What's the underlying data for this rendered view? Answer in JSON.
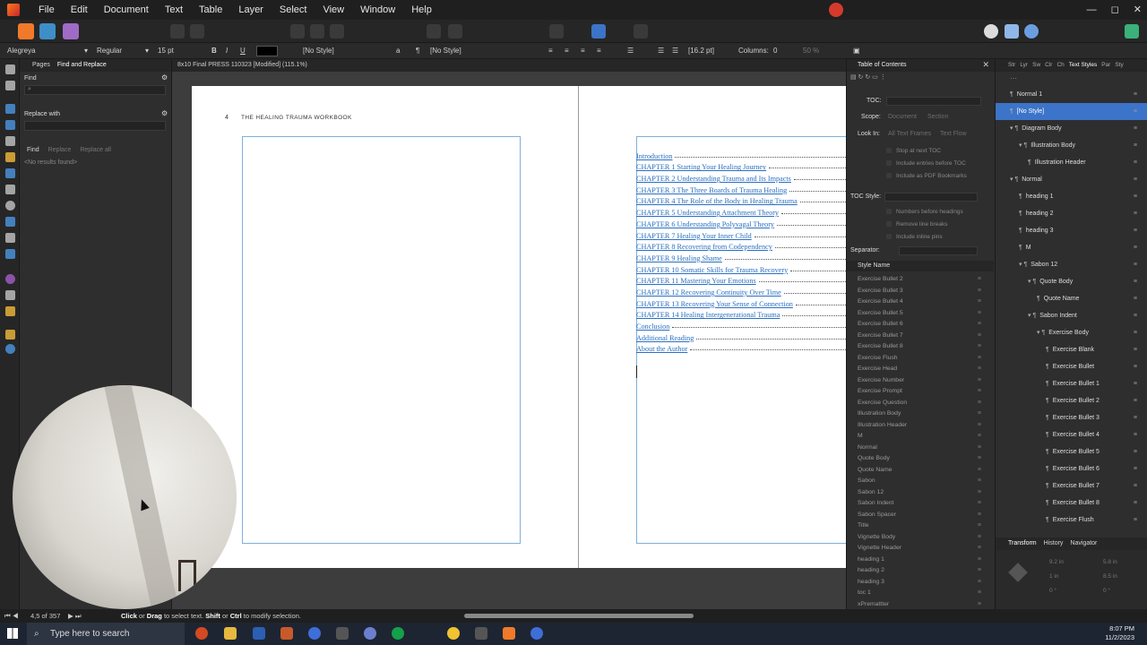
{
  "app": {
    "menus": [
      "File",
      "Edit",
      "Document",
      "Text",
      "Table",
      "Layer",
      "Select",
      "View",
      "Window",
      "Help"
    ],
    "window_controls": [
      "—",
      "◻",
      "✕"
    ]
  },
  "context_bar": {
    "font": "Alegreya",
    "weight": "Regular",
    "size": "15 pt",
    "bold": "B",
    "italic": "I",
    "underline": "U",
    "char_style": "[No Style]",
    "para_style": "[No Style]",
    "leading": "[16.2 pt]",
    "columns_label": "Columns:",
    "columns_value": "0",
    "zoom": "50 %"
  },
  "find_panel": {
    "tabs": [
      "Pages",
      "Find and Replace"
    ],
    "find_label": "Find",
    "find_placeholder": "",
    "replace_label": "Replace with",
    "find_btn": "Find",
    "replace_btn": "Replace",
    "replace_all_btn": "Replace all",
    "results": "<No results found>"
  },
  "document": {
    "tab_title": "8x10 Final PRESS 110323 [Modified] (115.1%)",
    "page_number": "4",
    "running_head": "THE HEALING TRAUMA WORKBOOK",
    "toc_entries": [
      "Introduction",
      "CHAPTER 1 Starting Your Healing Journey",
      "CHAPTER 2 Understanding Trauma and Its Impacts",
      "CHAPTER 3 The Three Boards of Trauma Healing",
      "CHAPTER 4 The Role of the Body in Healing Trauma",
      "CHAPTER 5 Understanding Attachment Theory",
      "CHAPTER 6 Understanding Polyvagal Theory",
      "CHAPTER 7 Healing Your Inner Child",
      "CHAPTER 8 Recovering from Codependency",
      "CHAPTER 9 Healing Shame",
      "CHAPTER 10 Somatic Skills for Trauma Recovery",
      "CHAPTER 11 Mastering Your Emotions",
      "CHAPTER 12 Recovering Continuity Over Time",
      "CHAPTER 13 Recovering Your Sense of Connection",
      "CHAPTER 14 Healing Intergenerational Trauma",
      "Conclusion",
      "Additional Reading",
      "About the Author"
    ]
  },
  "toc_panel": {
    "title": "Table of Contents",
    "toc_label": "TOC:",
    "scope_label": "Scope:",
    "scope_options": [
      "Document",
      "Section"
    ],
    "look_in_label": "Look In:",
    "look_in_options": [
      "All Text Frames",
      "Text Flow"
    ],
    "checks": [
      "Stop at next TOC",
      "Include entries before TOC",
      "Include as PDF Bookmarks"
    ],
    "toc_style_label": "TOC Style:",
    "style_checks": [
      "Numbers before headings",
      "Remove line breaks",
      "Include inline pins"
    ],
    "separator_label": "Separator:",
    "style_name_header": "Style Name",
    "styles": [
      "Exercise Bullet 2",
      "Exercise Bullet 3",
      "Exercise Bullet 4",
      "Exercise Bullet 5",
      "Exercise Bullet 6",
      "Exercise Bullet 7",
      "Exercise Bullet 8",
      "Exercise Flush",
      "Exercise Head",
      "Exercise Number",
      "Exercise Prompt",
      "Exercise Question",
      "Illustration Body",
      "Illustration Header",
      "M",
      "Normal",
      "Quote Body",
      "Quote Name",
      "Sabon",
      "Sabon 12",
      "Sabon Indent",
      "Sabon Spacer",
      "Title",
      "Vignette Body",
      "Vignette Header",
      "heading 1",
      "heading 2",
      "heading 3",
      "toc 1",
      "xPremattter"
    ]
  },
  "styles_panel": {
    "tabs": [
      "Str",
      "Lyr",
      "Sw",
      "Clr",
      "Ch",
      "Text Styles",
      "Par",
      "Sty"
    ],
    "active_tab": "Text Styles",
    "tree": [
      {
        "label": "Normal 1",
        "indent": 1,
        "selected": false,
        "marker": "¶"
      },
      {
        "label": "[No Style]",
        "indent": 1,
        "selected": true,
        "marker": "¶"
      },
      {
        "label": "Diagram Body",
        "indent": 1,
        "selected": false,
        "marker": "▾ ¶"
      },
      {
        "label": "Illustration Body",
        "indent": 2,
        "selected": false,
        "marker": "▾ ¶"
      },
      {
        "label": "Illustration Header",
        "indent": 3,
        "selected": false,
        "marker": "¶"
      },
      {
        "label": "Normal",
        "indent": 1,
        "selected": false,
        "marker": "▾ ¶"
      },
      {
        "label": "heading 1",
        "indent": 2,
        "selected": false,
        "marker": "¶"
      },
      {
        "label": "heading 2",
        "indent": 2,
        "selected": false,
        "marker": "¶"
      },
      {
        "label": "heading 3",
        "indent": 2,
        "selected": false,
        "marker": "¶"
      },
      {
        "label": "M",
        "indent": 2,
        "selected": false,
        "marker": "¶"
      },
      {
        "label": "Sabon 12",
        "indent": 2,
        "selected": false,
        "marker": "▾ ¶"
      },
      {
        "label": "Quote Body",
        "indent": 3,
        "selected": false,
        "marker": "▾ ¶"
      },
      {
        "label": "Quote Name",
        "indent": 4,
        "selected": false,
        "marker": "¶"
      },
      {
        "label": "Sabon Indent",
        "indent": 3,
        "selected": false,
        "marker": "▾ ¶"
      },
      {
        "label": "Exercise Body",
        "indent": 4,
        "selected": false,
        "marker": "▾ ¶"
      },
      {
        "label": "Exercise Blank",
        "indent": 5,
        "selected": false,
        "marker": "¶"
      },
      {
        "label": "Exercise Bullet",
        "indent": 5,
        "selected": false,
        "marker": "¶"
      },
      {
        "label": "Exercise Bullet 1",
        "indent": 5,
        "selected": false,
        "marker": "¶"
      },
      {
        "label": "Exercise Bullet 2",
        "indent": 5,
        "selected": false,
        "marker": "¶"
      },
      {
        "label": "Exercise Bullet 3",
        "indent": 5,
        "selected": false,
        "marker": "¶"
      },
      {
        "label": "Exercise Bullet 4",
        "indent": 5,
        "selected": false,
        "marker": "¶"
      },
      {
        "label": "Exercise Bullet 5",
        "indent": 5,
        "selected": false,
        "marker": "¶"
      },
      {
        "label": "Exercise Bullet 6",
        "indent": 5,
        "selected": false,
        "marker": "¶"
      },
      {
        "label": "Exercise Bullet 7",
        "indent": 5,
        "selected": false,
        "marker": "¶"
      },
      {
        "label": "Exercise Bullet 8",
        "indent": 5,
        "selected": false,
        "marker": "¶"
      },
      {
        "label": "Exercise Flush",
        "indent": 5,
        "selected": false,
        "marker": "¶"
      }
    ],
    "bottom_tabs": [
      "Transform",
      "History",
      "Navigator"
    ],
    "transform": {
      "x": "9.2 in",
      "y": "1 in",
      "w": "5.8 in",
      "h": "8.5 in",
      "r": "0 °",
      "s": "0 °"
    }
  },
  "status": {
    "page_info": "4,5 of 357",
    "hint_click": "Click",
    "hint_or": " or ",
    "hint_drag": "Drag",
    "hint_mid": " to select text. ",
    "hint_shift": "Shift",
    "hint_or2": " or ",
    "hint_ctrl": "Ctrl",
    "hint_end": " to modify selection."
  },
  "taskbar": {
    "search_placeholder": "Type here to search",
    "time": "8:07 PM",
    "date": "11/2/2023"
  },
  "colors": {
    "accent": "#3c74c9",
    "toc_link": "#2a6fc0",
    "frame_outline": "#7fb0d8"
  }
}
